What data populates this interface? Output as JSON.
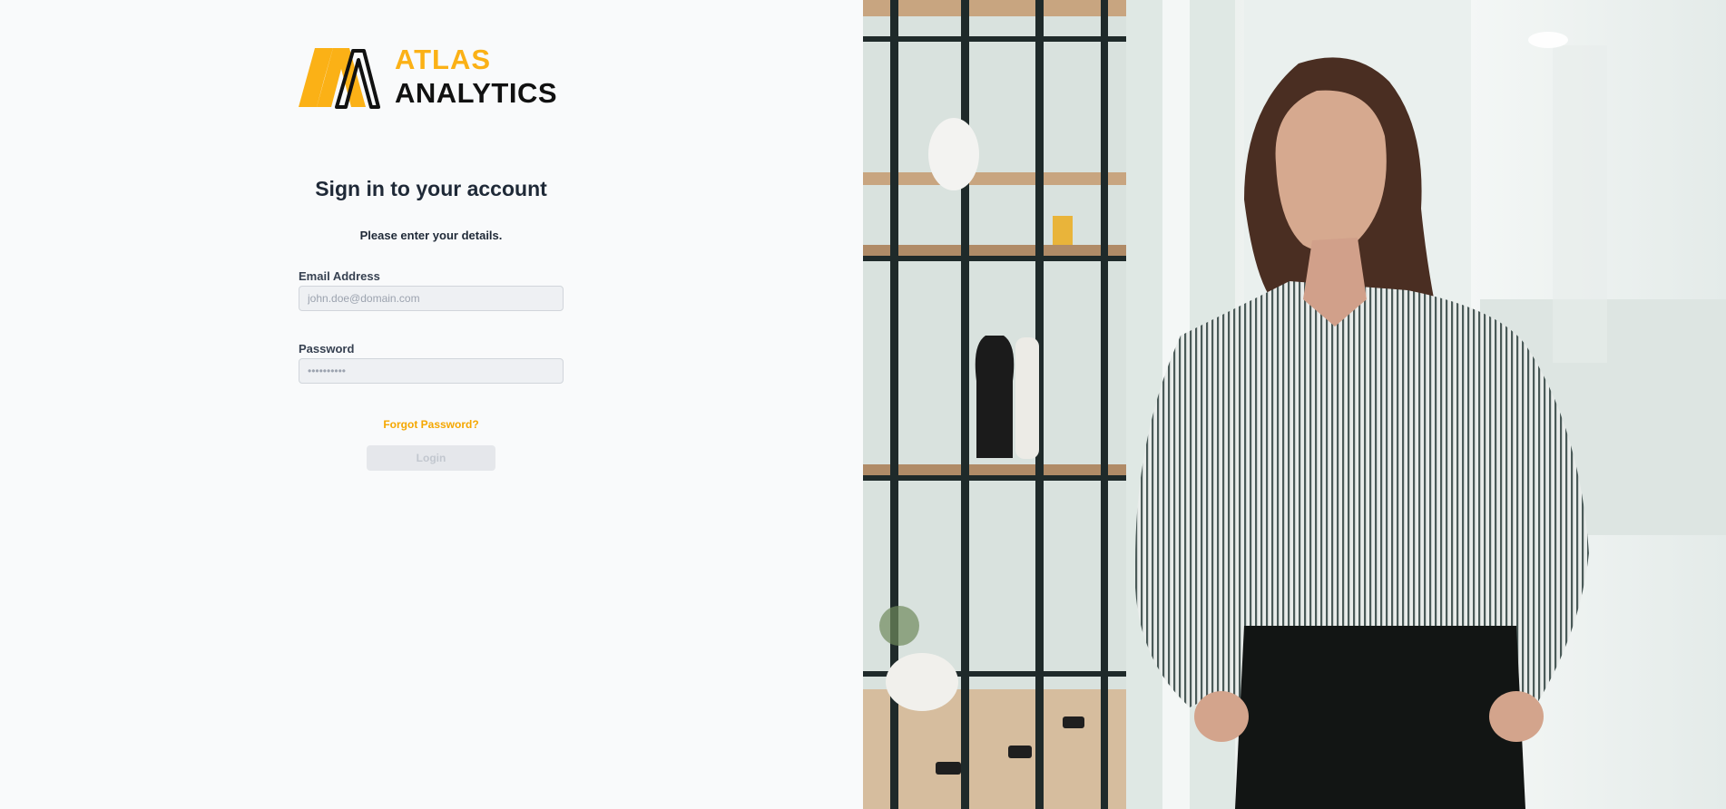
{
  "brand": {
    "line1": "ATLAS",
    "line2": "ANALYTICS",
    "colors": {
      "accent": "#fbb116",
      "dark": "#111111"
    }
  },
  "login": {
    "title": "Sign in to your account",
    "subtitle": "Please enter your details.",
    "email": {
      "label": "Email Address",
      "placeholder": "john.doe@domain.com",
      "value": ""
    },
    "password": {
      "label": "Password",
      "placeholder": "••••••••••",
      "value": ""
    },
    "forgot_label": "Forgot Password?",
    "login_label": "Login"
  },
  "hero": {
    "image": "woman-in-office-photo"
  }
}
